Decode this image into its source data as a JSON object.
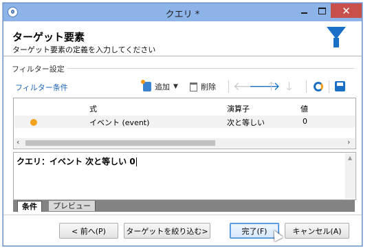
{
  "window": {
    "title": "クエリ *"
  },
  "header": {
    "title": "ターゲット要素",
    "subtitle": "ターゲット要素の定義を入力してください",
    "icon": "funnel-icon"
  },
  "filter_group": {
    "label": "フィルター設定"
  },
  "toolbar": {
    "conditions_label": "フィルター条件",
    "add_label": "追加",
    "delete_label": "削除"
  },
  "grid": {
    "columns": [
      "式",
      "演算子",
      "値"
    ],
    "rows": [
      {
        "expression": "イベント (event)",
        "operator": "次と等しい",
        "value": "0"
      }
    ]
  },
  "expression_preview": "クエリ：イベント 次と等しい 0",
  "tabs": [
    "条件",
    "プレビュー"
  ],
  "buttons": {
    "back": "< 前へ(P)",
    "narrow": "ターゲットを絞り込む>",
    "finish": "完了(F)",
    "cancel": "キャンセル(A)"
  },
  "colors": {
    "accent": "#1a6fc7",
    "titlebar": "#8db4e8",
    "close": "#c7504a",
    "dot": "#f3a21c"
  }
}
